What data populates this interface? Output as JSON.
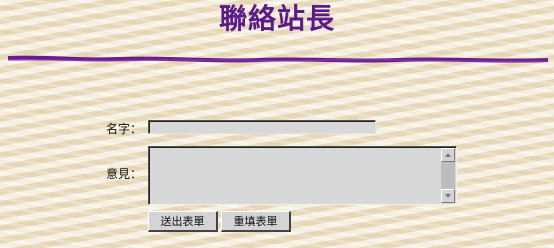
{
  "page": {
    "title": "聯絡站長"
  },
  "form": {
    "name_label": "名字：",
    "name_value": "",
    "opinion_label": "意見：",
    "opinion_value": "",
    "submit_label": "送出表單",
    "reset_label": "重填表單"
  },
  "colors": {
    "title": "#5a1a8a",
    "divider": "#6a1c8c",
    "background": "#efe3c9"
  }
}
